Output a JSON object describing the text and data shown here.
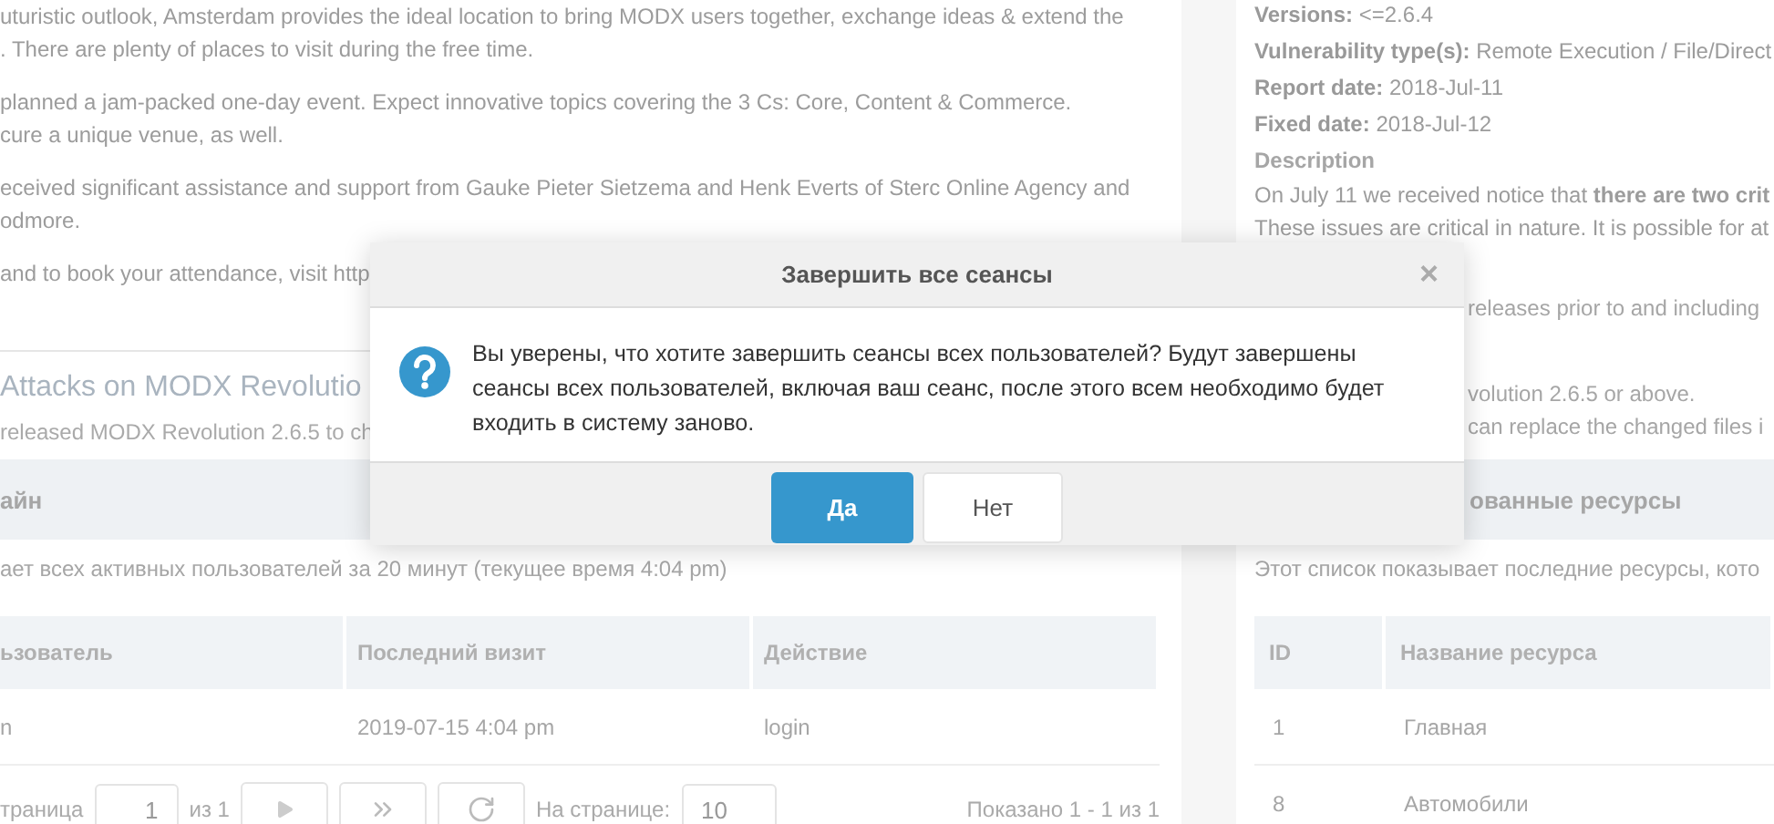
{
  "news": {
    "paragraphs": [
      "uturistic outlook, Amsterdam provides the ideal location to bring MODX users together, exchange ideas & extend the\n. There are plenty of places to visit during the free time.",
      "planned a jam-packed one-day event. Expect innovative topics covering the 3 Cs: Core, Content & Commerce.\ncure a unique venue, as well.",
      "eceived significant assistance and support from Gauke Pieter Sietzema and Henk Everts of Sterc Online Agency and\nodmore.",
      "and to book your attendance, visit http"
    ],
    "title": "Attacks on MODX Revolutio",
    "teaser": "released MODX Revolution 2.6.5 to ch"
  },
  "security": {
    "facts": [
      "**Versions:** <=2.6.4",
      "**Vulnerability type(s):** Remote Execution / File/Direct",
      "**Report date:** 2018-Jul-11",
      "**Fixed date:** 2018-Jul-12"
    ],
    "heading": "Description",
    "lines": [
      "On July 11 we received notice that **there are two crit**",
      "These issues are critical in nature. It is possible for at"
    ],
    "partial_lines": [
      "releases prior to and including",
      "volution 2.6.5 or above.",
      "can replace the changed files i"
    ]
  },
  "online": {
    "title": "айн",
    "description": "ает всех активных пользователей за 20 минут (текущее время 4:04 pm)",
    "columns": [
      "ьзователь",
      "Последний визит",
      "Действие"
    ],
    "rows": [
      [
        "n",
        "2019-07-15 4:04 pm",
        "login"
      ]
    ],
    "pager": {
      "page_label": "траница",
      "page": "1",
      "of": "из 1",
      "per_page_label": "На странице:",
      "per_page": "10",
      "summary": "Показано 1 - 1 из 1"
    }
  },
  "resources": {
    "title": "ованные ресурсы",
    "description": "Этот список показывает последние ресурсы, кото",
    "columns": [
      "ID",
      "Название ресурса"
    ],
    "rows": [
      [
        "1",
        "Главная"
      ],
      [
        "8",
        "Автомобили"
      ]
    ]
  },
  "dialog": {
    "title": "Завершить все сеансы",
    "close": "×",
    "message": "Вы уверены, что хотите завершить сеансы всех пользователей? Будут завершены сеансы всех пользователей, включая ваш сеанс, после этого всем необходимо будет входить в систему заново.",
    "buttons": [
      {
        "label": "Да",
        "primary": true
      },
      {
        "label": "Нет",
        "primary": false
      }
    ]
  }
}
